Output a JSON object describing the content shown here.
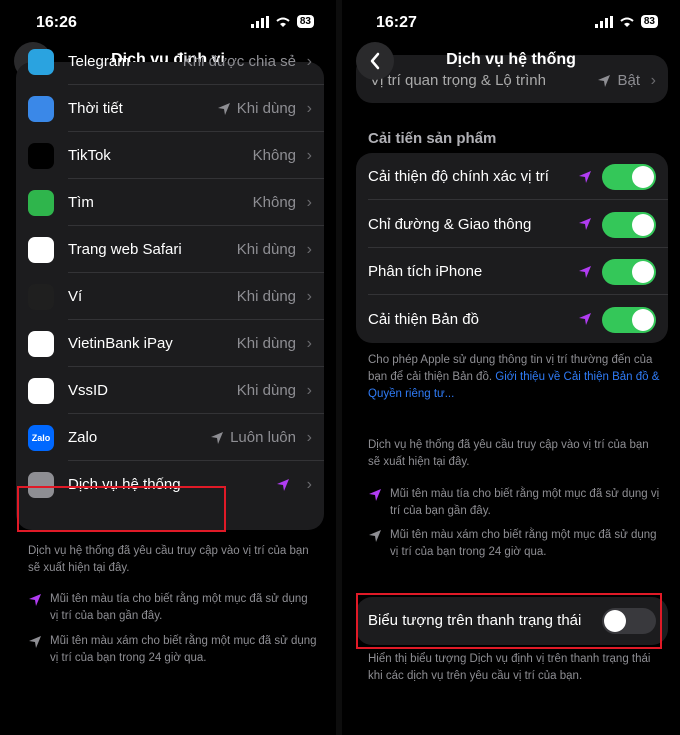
{
  "left": {
    "status": {
      "time": "16:26",
      "battery": "83"
    },
    "nav": {
      "title": "Dịch vụ định vị",
      "back_icon": "chevron-left-icon"
    },
    "apps": [
      {
        "name": "Telegram",
        "value": "Khi được chia sẻ",
        "icon_color": "#2aa3e0",
        "icon": "telegram-icon",
        "arrow": ""
      },
      {
        "name": "Thời tiết",
        "value": "Khi dùng",
        "icon_color": "#3a88e8",
        "icon": "weather-icon",
        "arrow": "gray"
      },
      {
        "name": "TikTok",
        "value": "Không",
        "icon_color": "#000000",
        "icon": "tiktok-icon",
        "arrow": ""
      },
      {
        "name": "Tìm",
        "value": "Không",
        "icon_color": "#2fb54c",
        "icon": "find-my-icon",
        "arrow": ""
      },
      {
        "name": "Trang web Safari",
        "value": "Khi dùng",
        "icon_color": "#ffffff",
        "icon": "safari-icon",
        "arrow": ""
      },
      {
        "name": "Ví",
        "value": "Khi dùng",
        "icon_color": "#1f1f1f",
        "icon": "wallet-icon",
        "arrow": ""
      },
      {
        "name": "VietinBank iPay",
        "value": "Khi dùng",
        "icon_color": "#ffffff",
        "icon": "vietinbank-icon",
        "arrow": ""
      },
      {
        "name": "VssID",
        "value": "Khi dùng",
        "icon_color": "#ffffff",
        "icon": "vssid-icon",
        "arrow": ""
      },
      {
        "name": "Zalo",
        "value": "Luôn luôn",
        "icon_color": "#0068ff",
        "icon": "zalo-icon",
        "icon_text": "Zalo",
        "arrow": "gray"
      },
      {
        "name": "Dịch vụ hệ thống",
        "value": "",
        "icon_color": "#8e8e93",
        "icon": "gear-icon",
        "arrow": "purple"
      }
    ],
    "footer_note": "Dịch vụ hệ thống đã yêu cầu truy cập vào vị trí của bạn sẽ xuất hiện tại đây.",
    "legend_purple": "Mũi tên màu tía cho biết rằng một mục đã sử dụng vị trí của bạn gần đây.",
    "legend_gray": "Mũi tên màu xám cho biết rằng một mục đã sử dụng vị trí của bạn trong 24 giờ qua."
  },
  "right": {
    "status": {
      "time": "16:27",
      "battery": "83"
    },
    "nav": {
      "title": "Dịch vụ hệ thống",
      "back_icon": "chevron-left-icon"
    },
    "top_row": {
      "label": "Vị trí quan trọng & Lộ trình",
      "value": "Bật"
    },
    "section_title": "Cải tiến sản phẩm",
    "toggles": [
      {
        "label": "Cải thiện độ chính xác vị trí",
        "on": true
      },
      {
        "label": "Chỉ đường & Giao thông",
        "on": true
      },
      {
        "label": "Phân tích iPhone",
        "on": true
      },
      {
        "label": "Cải thiện Bản đồ",
        "on": true
      }
    ],
    "product_note_a": "Cho phép Apple sử dụng thông tin vị trí thường đến của bạn để cải thiện Bản đồ.",
    "product_note_link": "Giới thiệu về Cải thiện Bản đồ & Quyền riêng tư...",
    "system_note": "Dịch vụ hệ thống đã yêu cầu truy cập vào vị trí của bạn sẽ xuất hiện tại đây.",
    "legend_purple": "Mũi tên màu tía cho biết rằng một mục đã sử dụng vị trí của bạn gần đây.",
    "legend_gray": "Mũi tên màu xám cho biết rằng một mục đã sử dụng vị trí của bạn trong 24 giờ qua.",
    "statusbar_toggle": {
      "label": "Biểu tượng trên thanh trạng thái",
      "on": false
    },
    "statusbar_note": "Hiển thị biểu tượng Dịch vụ định vị trên thanh trạng thái khi các dịch vụ trên yêu cầu vị trí của bạn."
  },
  "colors": {
    "accent_purple": "#b13cf2",
    "toggle_on": "#34c759",
    "highlight": "#e01a27",
    "link": "#2f7bf6"
  }
}
